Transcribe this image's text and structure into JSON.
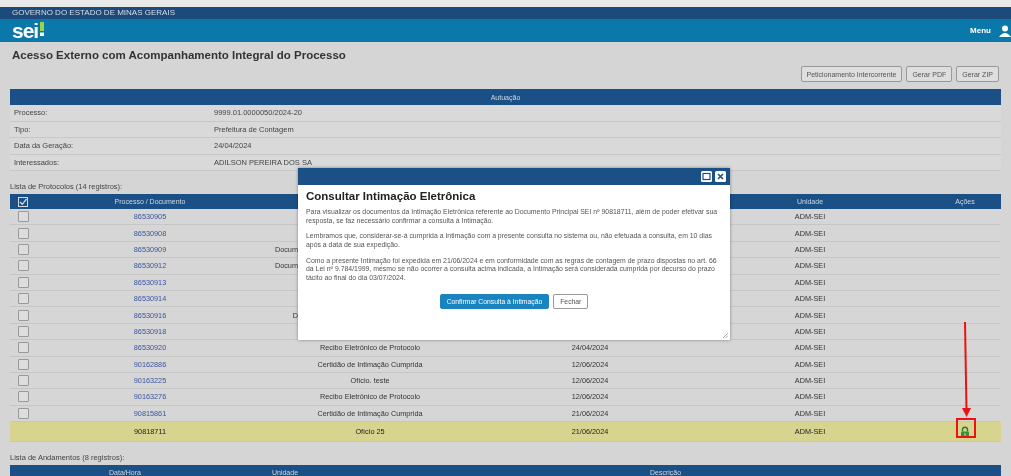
{
  "header": {
    "government": "GOVERNO DO ESTADO DE MINAS GERAIS",
    "logo": "sei",
    "menu": "Menu"
  },
  "title": "Acesso Externo com Acompanhamento Integral do Processo",
  "toolbar": [
    "Peticionamento Intercorrente",
    "Gerar PDF",
    "Gerar ZIP"
  ],
  "autuacao": {
    "heading": "Autuação",
    "rows": [
      {
        "label": "Processo:",
        "value": "9999.01.0000050/2024-20"
      },
      {
        "label": "Tipo:",
        "value": "Prefeitura de Contagem"
      },
      {
        "label": "Data da Geração:",
        "value": "24/04/2024"
      },
      {
        "label": "Interessados:",
        "value": "ADILSON PEREIRA DOS SA"
      }
    ]
  },
  "protocolos": {
    "caption": "Lista de Protocolos (14 registros):",
    "select_all": {
      "checked": true
    },
    "columns": [
      "Processo / Documento",
      "Unidade",
      "Ações"
    ],
    "rows": [
      {
        "kind": "selectable",
        "checked": false,
        "protocol": "86530905",
        "unidade": "ADM-SEI"
      },
      {
        "kind": "selectable",
        "checked": false,
        "protocol": "86530908",
        "unidade": "ADM-SEI"
      },
      {
        "kind": "selectable",
        "checked": false,
        "protocol": "86530909",
        "documento": "Docum",
        "unidade": "ADM-SEI"
      },
      {
        "kind": "selectable",
        "checked": false,
        "protocol": "86530912",
        "documento": "Docum",
        "unidade": "ADM-SEI"
      },
      {
        "kind": "selectable",
        "checked": false,
        "protocol": "86530913",
        "unidade": "ADM-SEI"
      },
      {
        "kind": "selectable",
        "checked": false,
        "protocol": "86530914",
        "unidade": "ADM-SEI"
      },
      {
        "kind": "selectable",
        "checked": false,
        "protocol": "86530916",
        "documento": "D",
        "unidade": "ADM-SEI"
      },
      {
        "kind": "selectable",
        "checked": false,
        "protocol": "86530918",
        "unidade": "ADM-SEI"
      },
      {
        "kind": "selectable",
        "checked": false,
        "protocol": "86530920",
        "documento": "Recibo Eletrônico de Protocolo",
        "data": "24/04/2024",
        "unidade": "ADM-SEI"
      },
      {
        "kind": "selectable",
        "checked": false,
        "protocol": "90162886",
        "documento": "Certidão de Intimação Cumprida",
        "data": "12/06/2024",
        "unidade": "ADM-SEI"
      },
      {
        "kind": "selectable",
        "checked": false,
        "protocol": "90163225",
        "documento": "Ofício. teste",
        "data": "12/06/2024",
        "unidade": "ADM-SEI"
      },
      {
        "kind": "selectable",
        "checked": false,
        "protocol": "90163276",
        "documento": "Recibo Eletrônico de Protocolo",
        "data": "12/06/2024",
        "unidade": "ADM-SEI"
      },
      {
        "kind": "selectable",
        "checked": false,
        "protocol": "90815861",
        "documento": "Certidão de Intimação Cumprida",
        "data": "21/06/2024",
        "unidade": "ADM-SEI"
      },
      {
        "kind": "intimation",
        "protocol": "90818711",
        "documento": "Ofício 25",
        "data": "21/06/2024",
        "unidade": "ADM-SEI",
        "locked": true
      }
    ]
  },
  "andamentos": {
    "caption": "Lista de Andamentos (8 registros):",
    "columns": [
      "Data/Hora",
      "Unidade",
      "Descrição"
    ]
  },
  "dialog": {
    "title": "Consultar Intimação Eletrônica",
    "paragraphs": [
      "Para visualizar os documentos da Intimação Eletrônica referente ao Documento Principal SEI nº 90818711, além de poder efetivar sua resposta, se faz necessário confirmar a consulta à Intimação.",
      "Lembramos que, considerar-se-á cumprida a Intimação com a presente consulta no sistema ou, não efetuada a consulta, em 10 dias após a data de sua expedição.",
      "Como a presente Intimação foi expedida em 21/06/2024 e em conformidade com as regras de contagem de prazo dispostas no art. 66 da Lei nº 9.784/1999, mesmo se não ocorrer a consulta acima indicada, a Intimação será considerada cumprida por decurso do prazo tácito ao final do dia 03/07/2024."
    ],
    "buttons": [
      {
        "label": "Confirmar Consulta à Intimação",
        "kind": "primary"
      },
      {
        "label": "Fechar",
        "kind": "secondary"
      }
    ]
  }
}
